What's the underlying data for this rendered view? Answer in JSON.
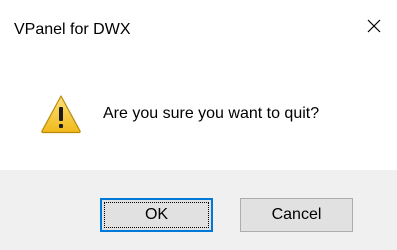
{
  "window": {
    "title": "VPanel for DWX",
    "close_icon": "close-icon"
  },
  "message": {
    "icon": "warning-icon",
    "text": "Are you sure you want to quit?"
  },
  "buttons": {
    "ok_label": "OK",
    "cancel_label": "Cancel"
  },
  "colors": {
    "accent": "#0078d7",
    "footer_bg": "#f0f0f0",
    "button_bg": "#e1e1e1",
    "warning_fill": "#f5c518"
  }
}
